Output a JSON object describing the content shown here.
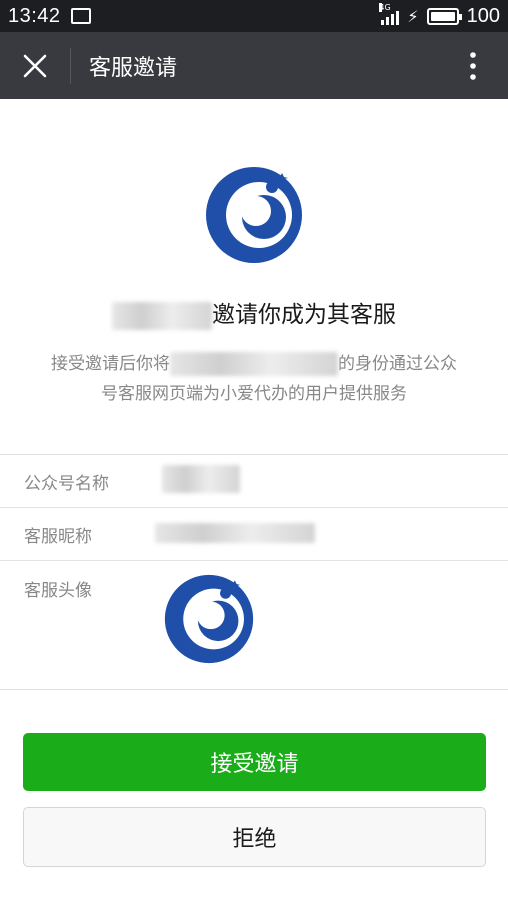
{
  "status_bar": {
    "time": "13:42",
    "network": "4G",
    "battery": "100"
  },
  "app_bar": {
    "title": "客服邀请",
    "close_icon": "close-icon",
    "more_icon": "more-vertical-icon"
  },
  "invite": {
    "heading_suffix": "邀请你成为其客服",
    "desc_line1_prefix": "接受邀请后你将",
    "desc_line1_suffix": "的身份通过公众",
    "desc_line2": "号客服网页端为小爱代办的用户提供服务"
  },
  "info": {
    "account_name_label": "公众号名称",
    "nickname_label": "客服昵称",
    "avatar_label": "客服头像"
  },
  "actions": {
    "accept_label": "接受邀请",
    "reject_label": "拒绝"
  },
  "colors": {
    "accent_green": "#1aad19",
    "appbar_bg": "#393a3f",
    "statusbar_bg": "#1d1e22",
    "logo_blue": "#1f4fa8"
  }
}
